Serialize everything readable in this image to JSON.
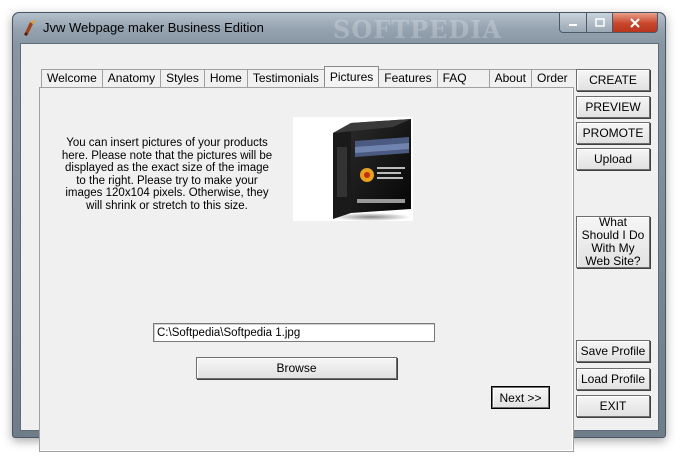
{
  "window": {
    "title": "Jvw Webpage maker Business Edition",
    "watermark": "SOFTPEDIA",
    "icons": {
      "app": "quill-icon",
      "minimize": "minimize-icon",
      "maximize": "maximize-icon",
      "close": "close-icon"
    },
    "colors": {
      "accent_close": "#c8462c",
      "client_bg": "#f0f0f0"
    }
  },
  "tabs": [
    {
      "label": "Welcome"
    },
    {
      "label": "Anatomy"
    },
    {
      "label": "Styles"
    },
    {
      "label": "Home"
    },
    {
      "label": "Testimonials"
    },
    {
      "label": "Pictures",
      "active": true
    },
    {
      "label": "Features"
    },
    {
      "label": "FAQ"
    },
    {
      "label": "About"
    },
    {
      "label": "Order"
    }
  ],
  "pictures": {
    "description": "You can insert pictures of your products here.  Please note that the pictures will be displayed as the exact size of the image to the right.  Please try to make your images 120x104 pixels.  Otherwise, they will shrink or stretch to this size.",
    "image_path": "C:\\Softpedia\\Softpedia 1.jpg",
    "browse_label": "Browse",
    "next_label": "Next >>"
  },
  "sidebar": {
    "create": "CREATE",
    "preview": "PREVIEW",
    "promote": "PROMOTE",
    "upload": "Upload",
    "what_should": "What Should I Do With My Web Site?",
    "save_profile": "Save Profile",
    "load_profile": "Load Profile",
    "exit": "EXIT"
  }
}
